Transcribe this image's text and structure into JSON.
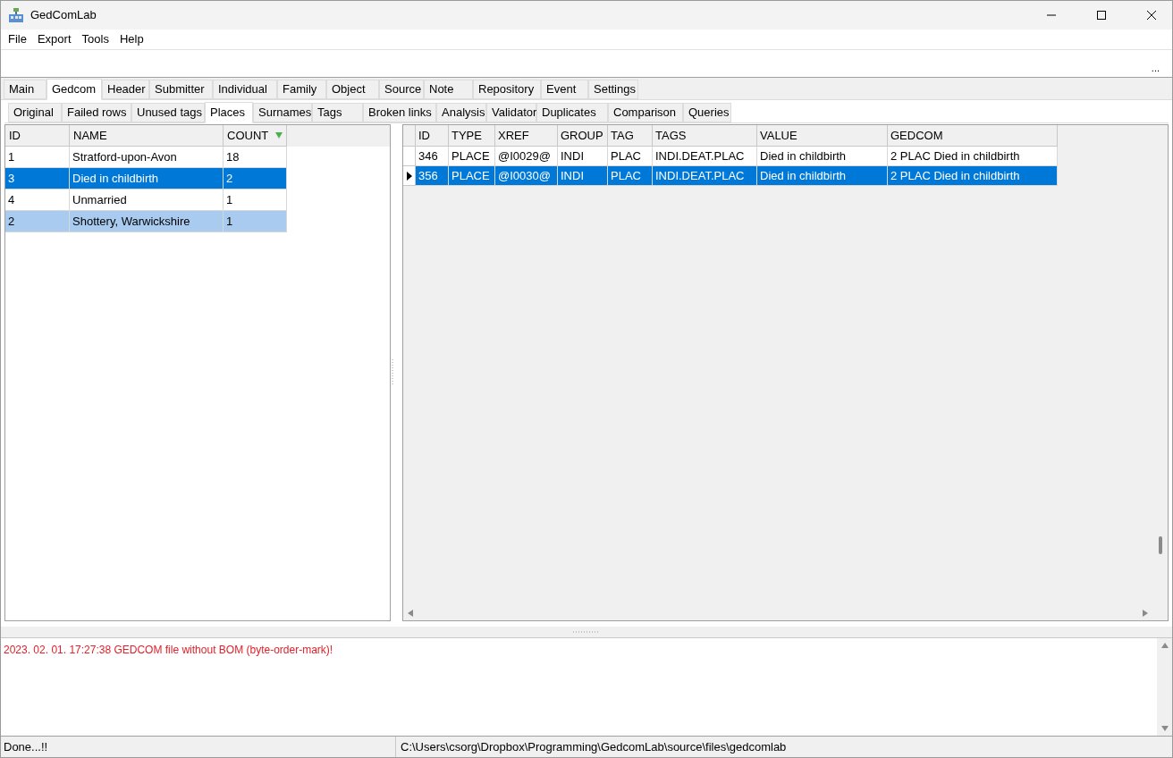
{
  "window": {
    "title": "GedComLab"
  },
  "menu": [
    "File",
    "Export",
    "Tools",
    "Help"
  ],
  "toolbar": {
    "overflow": "..."
  },
  "main_tabs": [
    {
      "label": "Main",
      "selected": false
    },
    {
      "label": "Gedcom",
      "selected": true
    },
    {
      "label": "Header",
      "selected": false
    },
    {
      "label": "Submitter",
      "selected": false
    },
    {
      "label": "Individual",
      "selected": false
    },
    {
      "label": "Family",
      "selected": false
    },
    {
      "label": "Object",
      "selected": false
    },
    {
      "label": "Source",
      "selected": false
    },
    {
      "label": "Note",
      "selected": false
    },
    {
      "label": "Repository",
      "selected": false
    },
    {
      "label": "Event",
      "selected": false
    },
    {
      "label": "Settings",
      "selected": false
    }
  ],
  "sub_tabs": [
    {
      "label": "Original",
      "selected": false
    },
    {
      "label": "Failed rows",
      "selected": false
    },
    {
      "label": "Unused tags",
      "selected": false
    },
    {
      "label": "Places",
      "selected": true
    },
    {
      "label": "Surnames",
      "selected": false
    },
    {
      "label": "Tags",
      "selected": false
    },
    {
      "label": "Broken links",
      "selected": false
    },
    {
      "label": "Analysis",
      "selected": false
    },
    {
      "label": "Validator",
      "selected": false
    },
    {
      "label": "Duplicates",
      "selected": false
    },
    {
      "label": "Comparison",
      "selected": false
    },
    {
      "label": "Queries",
      "selected": false
    }
  ],
  "places_table": {
    "columns": [
      {
        "label": "ID",
        "sorted": false
      },
      {
        "label": "NAME",
        "sorted": false
      },
      {
        "label": "COUNT",
        "sorted": true
      }
    ],
    "rows": [
      {
        "cells": [
          "1",
          "Stratford-upon-Avon",
          "18"
        ],
        "selected": false,
        "highlighted": false
      },
      {
        "cells": [
          "3",
          "Died in childbirth",
          "2"
        ],
        "selected": true,
        "highlighted": false
      },
      {
        "cells": [
          "4",
          "Unmarried",
          "1"
        ],
        "selected": false,
        "highlighted": false
      },
      {
        "cells": [
          "2",
          "Shottery, Warwickshire",
          "1"
        ],
        "selected": false,
        "highlighted": true
      }
    ]
  },
  "records_table": {
    "columns": [
      "ID",
      "TYPE",
      "XREF",
      "GROUP",
      "TAG",
      "TAGS",
      "VALUE",
      "GEDCOM"
    ],
    "rows": [
      {
        "cells": [
          "346",
          "PLACE",
          "@I0029@",
          "INDI",
          "PLAC",
          "INDI.DEAT.PLAC",
          "Died in childbirth",
          "2 PLAC Died in childbirth"
        ],
        "selected": false
      },
      {
        "cells": [
          "356",
          "PLACE",
          "@I0030@",
          "INDI",
          "PLAC",
          "INDI.DEAT.PLAC",
          "Died in childbirth",
          "2 PLAC Died in childbirth"
        ],
        "selected": true
      }
    ]
  },
  "log": [
    "2023. 02. 01. 17:27:38 GEDCOM file without BOM (byte-order-mark)!"
  ],
  "status_bar": {
    "message": "Done...!!",
    "path": "C:\\Users\\csorg\\Dropbox\\Programming\\GedcomLab\\source\\files\\gedcomlab"
  }
}
